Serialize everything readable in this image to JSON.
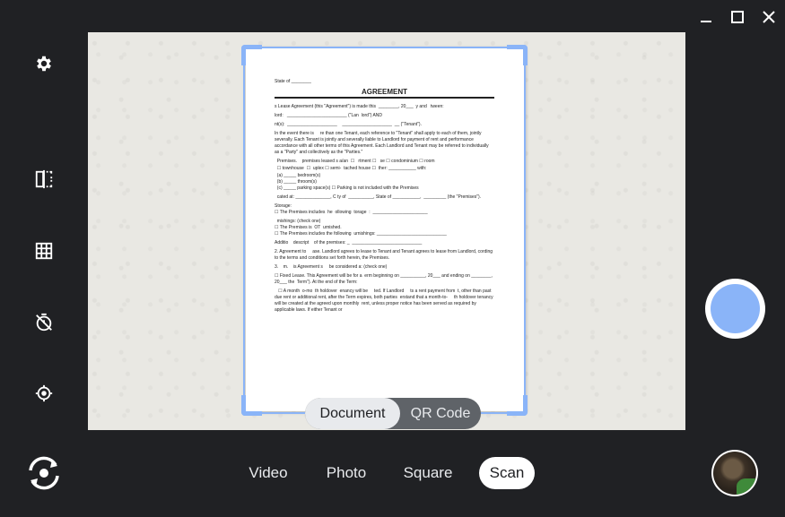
{
  "window_controls": {
    "minimize": "minimize-icon",
    "maximize": "maximize-icon",
    "close": "close-icon"
  },
  "sidebar": [
    {
      "name": "settings-icon"
    },
    {
      "name": "mirror-icon"
    },
    {
      "name": "grid-icon"
    },
    {
      "name": "timer-off-icon"
    },
    {
      "name": "focus-icon"
    }
  ],
  "scan_toggle": {
    "document": "Document",
    "qr_code": "QR Code",
    "selected": "document"
  },
  "modes": [
    "Video",
    "Photo",
    "Square",
    "Scan"
  ],
  "selected_mode": "Scan",
  "colors": {
    "accent": "#8ab4f8",
    "background": "#202124"
  },
  "document": {
    "state_of": "State of ________",
    "title": "AGREEMENT",
    "lines": [
      "s Lease Agreement (this \"Agreement\") is made this  ________, 20___  y and   tween:",
      "lord:   ________________________ (\"Lan  lord\") AND",
      "nt(s):  ____________________    ____________________  __ (\"Tenant\").",
      "In the event there is     re than one Tenant, each reference to \"Tenant\" shall apply to each of them, jointly severally. Each Tenant is jointly and severally liable to Landlord for payment of rent and performance accordance with all other terms of this Agreement. Each Landlord and Tenant may be referred to individually as a \"Party\" and collectively as the \"Parties.\"",
      "  Premises.    premises leased s a/an  ☐   rtment ☐   se ☐ condominium ☐ room",
      "  ☐ townhouse  ☐  uplex ☐ semi-  tached house ☐  ther: ___________ with:",
      "  (a) _____ bedroom(s)",
      "  (b) _____ throom(s)",
      "  (c) _____ parking space(s) ☐ Parking is not included with the Premises",
      "  cated at: ______________, C ty of  __________, State of ___________,  _________ (the \"Premises\").",
      "Storage:",
      "☐ The Premises includes  he  ollowing  torage  :  ______________________",
      "  mishings: (check one)",
      "☐ The Premises is  OT  urnished.",
      "☐ The Premises includes the following  urnishings: ____________________________",
      "Additio    descript    of the premises: _  ____________________________",
      "2. Agreement to     ase. Landlord agrees to lease to Tenant and Tenant agrees to lease from Landlord, cording to the terms and conditions set forth herein, the Premises.",
      "3.    m.    is Agreement s     be considered a: (check one)",
      "☐ Fixed Lease. This Agreement will be for a  erm beginning on __________, 20___ and ending on ________, 20___ the  Term\"). At the end of the Term:",
      "   ☐ A month  o-mo  th holdover  enancy will be     ted. If Landlord     ts a rent payment from  t, other than past due rent or additional rent, after the Term expires, both parties  erstand that a month-to-     th holdover tenancy will be created at the agreed upon monthly  rent, unless proper notice has been served as required by applicable laws. If either Tenant or"
    ]
  }
}
